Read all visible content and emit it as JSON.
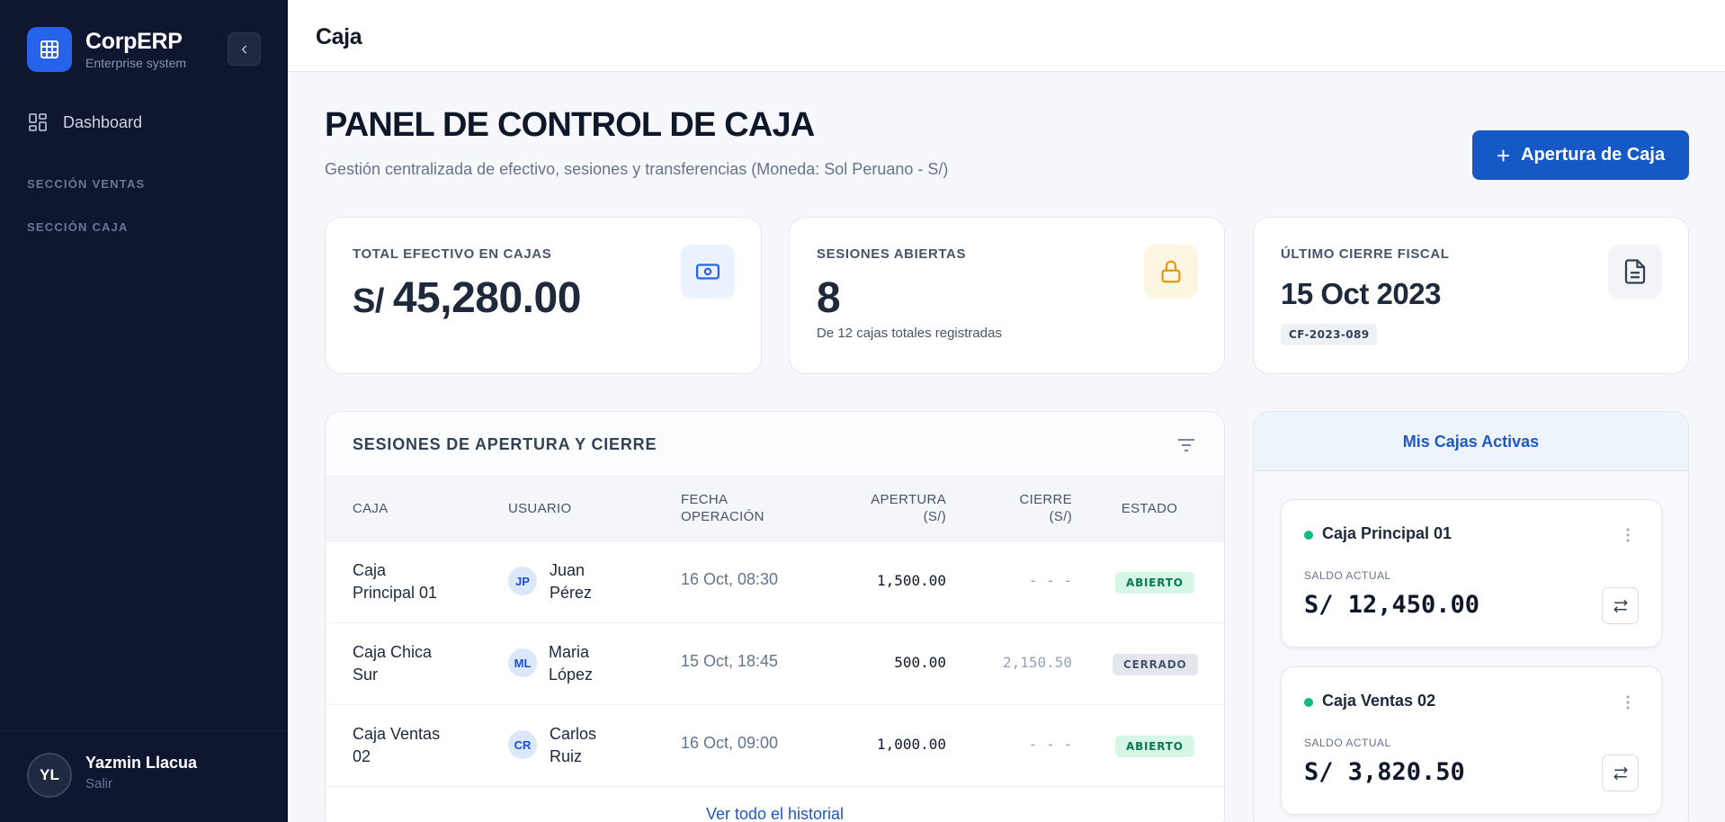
{
  "app": {
    "name": "CorpERP",
    "subtitle": "Enterprise system"
  },
  "sidebar": {
    "nav": [
      {
        "label": "Dashboard",
        "icon": "grid-icon"
      }
    ],
    "sections": [
      "SECCIÓN VENTAS",
      "SECCIÓN CAJA"
    ],
    "user": {
      "initials": "YL",
      "name": "Yazmin Llacua",
      "logout": "Salir"
    }
  },
  "topbar": {
    "title": "Caja"
  },
  "header": {
    "title": "PANEL DE CONTROL DE CAJA",
    "subtitle": "Gestión centralizada de efectivo, sesiones y transferencias (Moneda: Sol Peruano - S/)",
    "primary_button": "Apertura de Caja"
  },
  "stats": [
    {
      "label": "TOTAL EFECTIVO EN CAJAS",
      "currency": "S/",
      "value": "45,280.00",
      "icon": "cash-icon"
    },
    {
      "label": "SESIONES ABIERTAS",
      "value": "8",
      "note": "De 12 cajas totales registradas",
      "icon": "lock-icon"
    },
    {
      "label": "ÚLTIMO CIERRE FISCAL",
      "value": "15 Oct 2023",
      "chip": "CF-2023-089",
      "icon": "document-icon"
    }
  ],
  "sessions": {
    "title": "SESIONES DE APERTURA Y CIERRE",
    "columns": {
      "caja": "CAJA",
      "usuario": "USUARIO",
      "fecha_1": "FECHA",
      "fecha_2": "OPERACIÓN",
      "apertura_1": "APERTURA",
      "apertura_2": "(S/)",
      "cierre_1": "CIERRE",
      "cierre_2": "(S/)",
      "estado": "ESTADO"
    },
    "rows": [
      {
        "caja_1": "Caja",
        "caja_2": "Principal 01",
        "initials": "JP",
        "user_1": "Juan",
        "user_2": "Pérez",
        "fecha": "16 Oct, 08:30",
        "apertura": "1,500.00",
        "cierre": "- - -",
        "estado": "ABIERTO"
      },
      {
        "caja_1": "Caja Chica",
        "caja_2": "Sur",
        "initials": "ML",
        "user_1": "Maria",
        "user_2": "López",
        "fecha": "15 Oct, 18:45",
        "apertura": "500.00",
        "cierre": "2,150.50",
        "estado": "CERRADO"
      },
      {
        "caja_1": "Caja Ventas",
        "caja_2": "02",
        "initials": "CR",
        "user_1": "Carlos",
        "user_2": "Ruiz",
        "fecha": "16 Oct, 09:00",
        "apertura": "1,000.00",
        "cierre": "- - -",
        "estado": "ABIERTO"
      }
    ],
    "view_all": "Ver todo el historial"
  },
  "active_boxes": {
    "title": "Mis Cajas Activas",
    "items": [
      {
        "name": "Caja Principal 01",
        "label": "SALDO ACTUAL",
        "value": "S/ 12,450.00"
      },
      {
        "name": "Caja Ventas 02",
        "label": "SALDO ACTUAL",
        "value": "S/ 3,820.50"
      }
    ]
  },
  "colors": {
    "sidebar": "#0e1630",
    "primary": "#1559c7",
    "success": "#10b981",
    "muted": "#64748b"
  }
}
